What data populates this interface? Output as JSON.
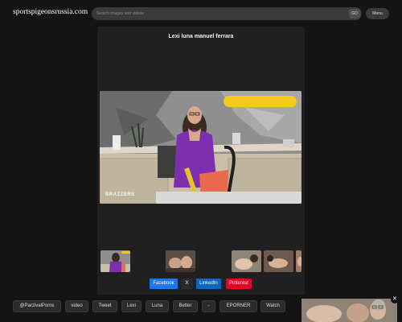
{
  "header": {
    "logo": "sportspigeonsrussia.com",
    "search_placeholder": "Search images and videos",
    "go_label": "GO",
    "menu_label": "Menu"
  },
  "video": {
    "title": "Lexi luna manuel ferrara",
    "watermark": "BRAZZERS"
  },
  "share_buttons": [
    {
      "label": "Facebook",
      "color": "#1877f2"
    },
    {
      "label": "X",
      "color": "#2a2a2a"
    },
    {
      "label": "LinkedIn",
      "color": "#0a66c2"
    },
    {
      "label": "Pinterest",
      "color": "#e60023"
    }
  ],
  "tags": [
    "@ParzivalPorns",
    "video",
    "Tweet",
    "Lexi",
    "Luna",
    "Better",
    "-",
    "EPORNER",
    "Watch"
  ],
  "colors": {
    "background": "#141414",
    "card": "#202020",
    "promo_pill": "#f2ca1c"
  }
}
